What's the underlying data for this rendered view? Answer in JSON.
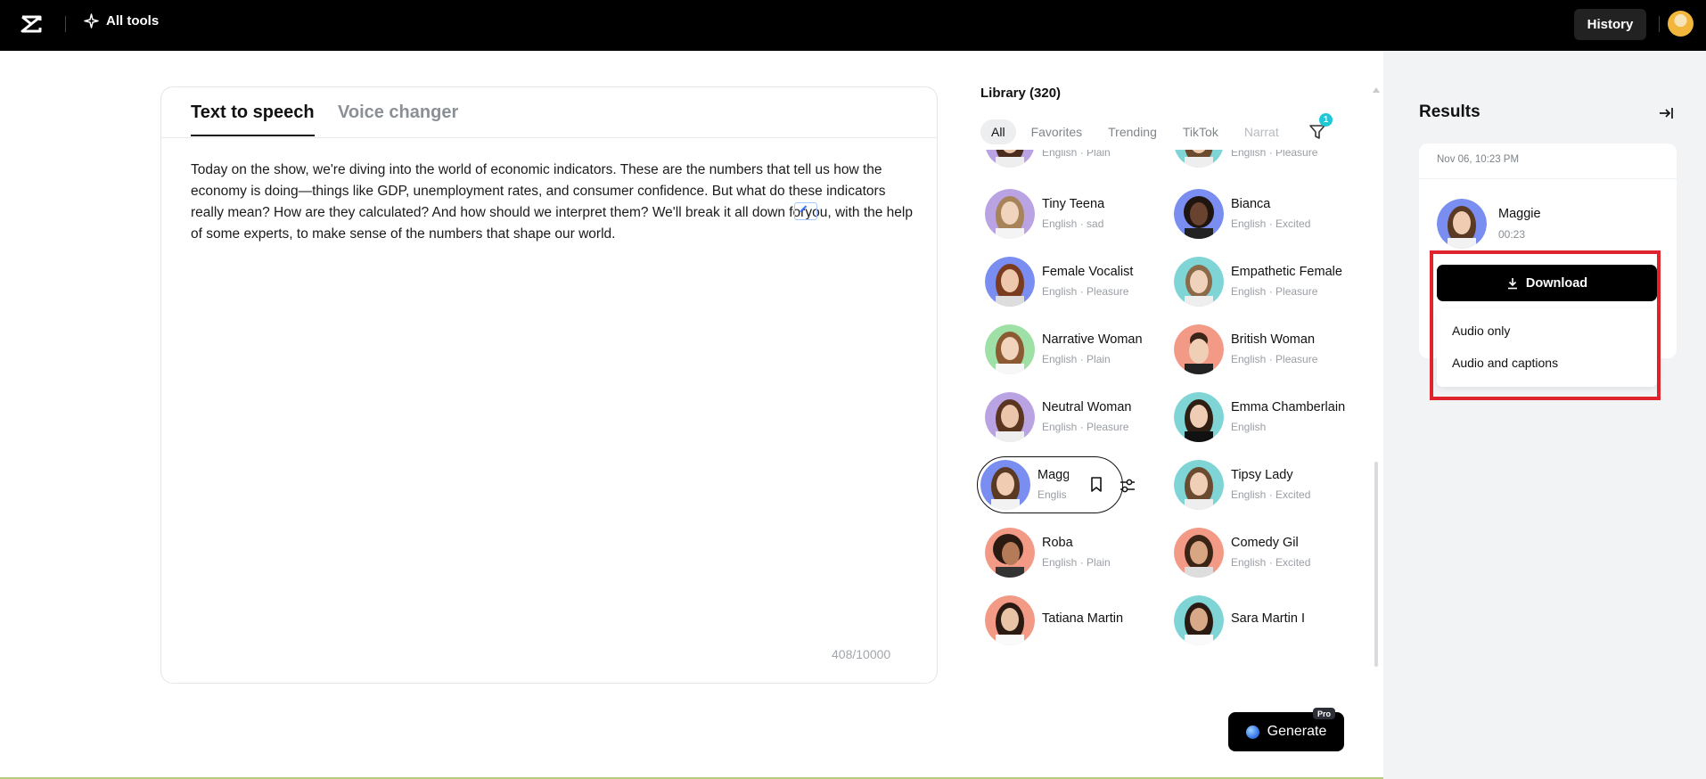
{
  "topbar": {
    "all_tools_label": "All tools",
    "history_label": "History"
  },
  "editor": {
    "tabs": [
      {
        "label": "Text to speech",
        "active": true
      },
      {
        "label": "Voice changer",
        "active": false
      }
    ],
    "text_before": "Today on the show, we're diving into the world of economic indicators. These are the numbers that tell us how the economy is doing—things like GDP, unemployment rates, and consumer confidence. But what do these indicators really mean? How are they calculated? And how should we interpret them? We'll break it all down for",
    "text_after": "you, with the help of some experts, to make sense of the numbers that shape our world.",
    "char_count": "408/10000"
  },
  "library": {
    "title": "Library (320)",
    "filters": [
      "All",
      "Favorites",
      "Trending",
      "TikTok",
      "Narrat"
    ],
    "active_filter": "All",
    "filter_badge": "1",
    "voices": [
      {
        "name": "",
        "desc": "English · Plain",
        "bg": "#b9a3e3",
        "hair": "#4a2b1c"
      },
      {
        "name": "",
        "desc": "English · Pleasure",
        "bg": "#7fd4d6",
        "hair": "#6b4a2e"
      },
      {
        "name": "Tiny Teena",
        "desc": "English · sad",
        "bg": "#b9a3e3",
        "hair": "#a7835a"
      },
      {
        "name": "Bianca",
        "desc": "English · Excited",
        "bg": "#7a8df0",
        "hair": "#1f1510"
      },
      {
        "name": "Female Vocalist",
        "desc": "English · Pleasure",
        "bg": "#7a8df0",
        "hair": "#7a3b1f"
      },
      {
        "name": "Empathetic Female",
        "desc": "English · Pleasure",
        "bg": "#7fd4d6",
        "hair": "#8a6a48"
      },
      {
        "name": "Narrative Woman",
        "desc": "English · Plain",
        "bg": "#9ee0a6",
        "hair": "#8c5a32"
      },
      {
        "name": "British Woman",
        "desc": "English · Pleasure",
        "bg": "#f29a86",
        "hair": "#3b2418"
      },
      {
        "name": "Neutral Woman",
        "desc": "English · Pleasure",
        "bg": "#b9a3e3",
        "hair": "#5a3620"
      },
      {
        "name": "Emma Chamberlain",
        "desc": "English",
        "bg": "#7fd4d6",
        "hair": "#2e1e14"
      },
      {
        "name": "Maggie",
        "desc": "English · Plain",
        "bg": "#7a8df0",
        "hair": "#5a3a22"
      },
      {
        "name": "Tipsy Lady",
        "desc": "English · Excited",
        "bg": "#7fd4d6",
        "hair": "#6a4a30"
      },
      {
        "name": "Roba",
        "desc": "English · Plain",
        "bg": "#f29a86",
        "hair": "#2a1a12"
      },
      {
        "name": "Comedy Gil",
        "desc": "English · Excited",
        "bg": "#f29a86",
        "hair": "#3a2416"
      },
      {
        "name": "Tatiana Martin",
        "desc": "",
        "bg": "#f29a86",
        "hair": "#2a1a12"
      },
      {
        "name": "Sara Martin I",
        "desc": "",
        "bg": "#7fd4d6",
        "hair": "#2a1a12"
      }
    ],
    "selected_voice": {
      "name_clip": "Magg",
      "desc_clip": "Englis"
    }
  },
  "generate": {
    "label": "Generate",
    "badge": "Pro"
  },
  "results": {
    "title": "Results",
    "date": "Nov 06, 10:23 PM",
    "voice_name": "Maggie",
    "duration": "00:23",
    "download_label": "Download",
    "options": [
      "Audio only",
      "Audio and captions"
    ]
  },
  "colors": {
    "highlight": "#e0242d",
    "badge": "#1ec8d8",
    "panel_bg": "#f1f3f5"
  }
}
